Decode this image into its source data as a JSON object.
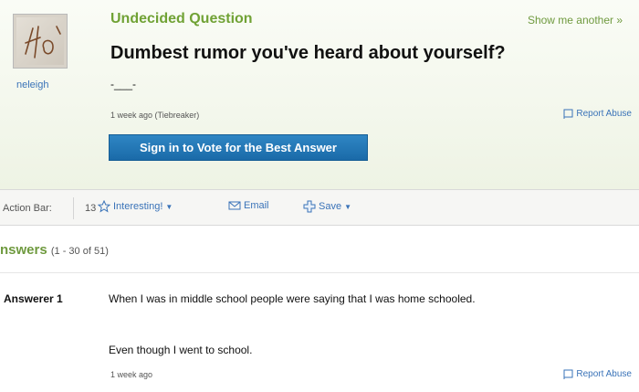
{
  "question": {
    "type_label": "Undecided Question",
    "show_another": "Show me another »",
    "title": "Dumbest rumor you've heard about yourself?",
    "detail": "-___-",
    "meta": "1 week ago (Tiebreaker)",
    "report_label": "Report Abuse",
    "vote_button": "Sign in to Vote for the Best Answer"
  },
  "asker": {
    "name": "neleigh",
    "avatar_icon": "hand-drawn-avatar"
  },
  "action_bar": {
    "label": "Action Bar:",
    "interesting_count": "13",
    "interesting_label": "Interesting!",
    "email_label": "Email",
    "save_label": "Save"
  },
  "answers": {
    "heading": "nswers",
    "count": "(1 - 30 of 51)",
    "items": [
      {
        "answerer": "Answerer 1",
        "text_1": "When I was in middle school people were saying that I was home schooled.",
        "text_2": "Even though I went to school.",
        "time": "1 week ago",
        "report_label": "Report Abuse"
      }
    ]
  },
  "colors": {
    "accent_green": "#70a235",
    "link_blue": "#3a73b8",
    "button_blue": "#1f72b0"
  }
}
